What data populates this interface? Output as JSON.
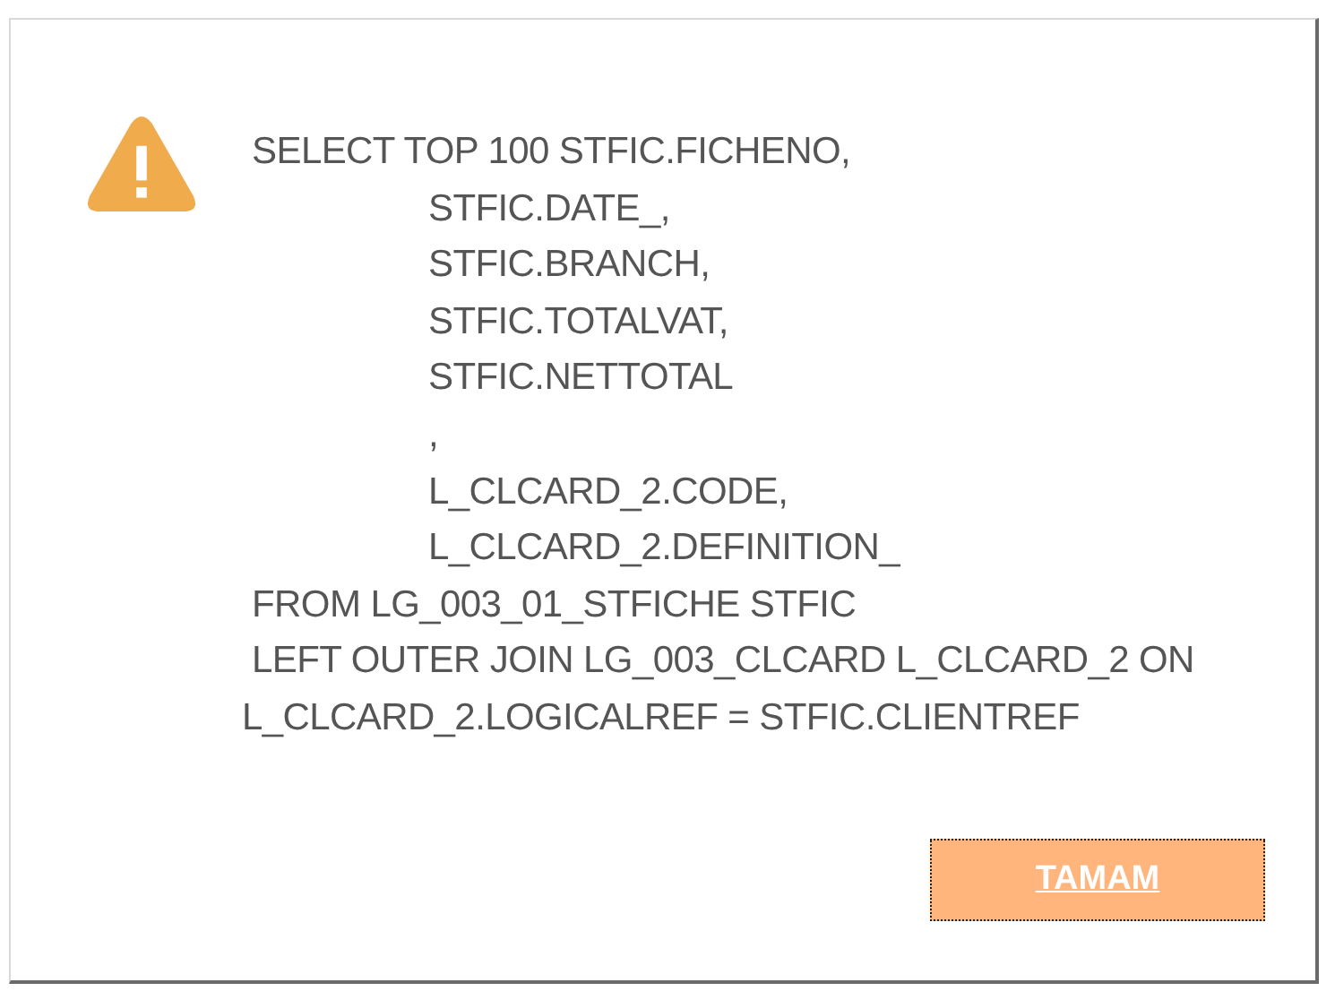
{
  "dialog": {
    "message": " SELECT TOP 100 STFIC.FICHENO,\n\tSTFIC.DATE_,\n\tSTFIC.BRANCH,\n\tSTFIC.TOTALVAT,\n\tSTFIC.NETTOTAL\n\t,\n\tL_CLCARD_2.CODE,\n\tL_CLCARD_2.DEFINITION_\n FROM LG_003_01_STFICHE STFIC\n LEFT OUTER JOIN LG_003_CLCARD L_CLCARD_2 ON\nL_CLCARD_2.LOGICALREF = STFIC.CLIENTREF",
    "buttons": [
      {
        "label": "TAMAM",
        "focused": true
      }
    ]
  }
}
